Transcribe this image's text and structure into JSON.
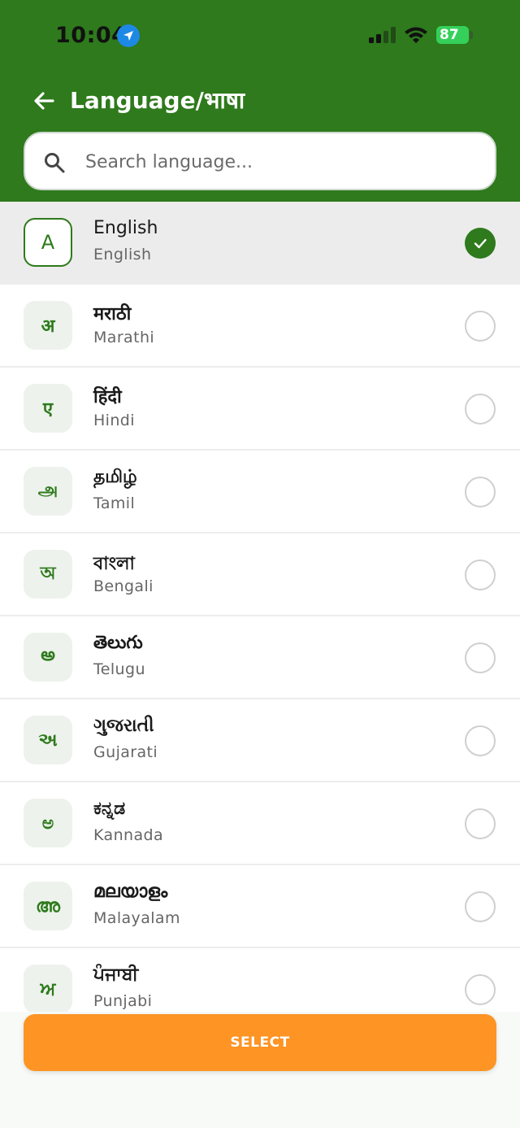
{
  "status_bar": {
    "time": "10:04",
    "battery": "87",
    "icons": [
      "location-arrow-icon",
      "signal-icon",
      "wifi-icon",
      "battery-icon"
    ]
  },
  "header": {
    "title": "Language/भाषा",
    "back_icon": "arrow-left-icon"
  },
  "search": {
    "placeholder": "Search language...",
    "value": "",
    "icon": "search-icon"
  },
  "languages": [
    {
      "letter": "A",
      "native": "English",
      "english": "English",
      "selected": true
    },
    {
      "letter": "अ",
      "native": "मराठी",
      "english": "Marathi",
      "selected": false
    },
    {
      "letter": "ए",
      "native": "हिंदी",
      "english": "Hindi",
      "selected": false
    },
    {
      "letter": "அ",
      "native": "தமிழ்",
      "english": "Tamil",
      "selected": false
    },
    {
      "letter": "অ",
      "native": "বাংলা",
      "english": "Bengali",
      "selected": false
    },
    {
      "letter": "అ",
      "native": "తెలుగు",
      "english": "Telugu",
      "selected": false
    },
    {
      "letter": "અ",
      "native": "ગુજરાતી",
      "english": "Gujarati",
      "selected": false
    },
    {
      "letter": "ಅ",
      "native": "ಕನ್ನಡ",
      "english": "Kannada",
      "selected": false
    },
    {
      "letter": "അ",
      "native": "മലയാളം",
      "english": "Malayalam",
      "selected": false
    },
    {
      "letter": "ਅ",
      "native": "ਪੰਜਾਬੀ",
      "english": "Punjabi",
      "selected": false
    }
  ],
  "footer": {
    "select_label": "SELECT"
  },
  "colors": {
    "primary_green": "#2e7a1c",
    "accent_orange": "#fd9424",
    "selected_row_bg": "#ececec"
  }
}
